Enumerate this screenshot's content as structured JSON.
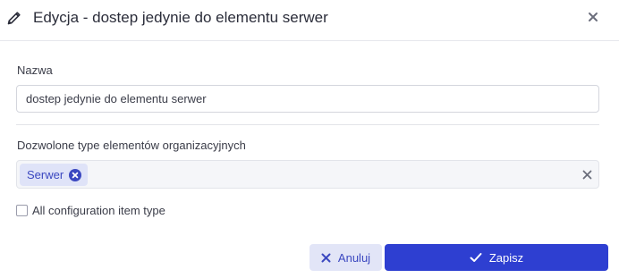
{
  "dialog": {
    "title": "Edycja - dostep jedynie do elementu serwer",
    "edit_icon": "pencil-icon",
    "close_icon": "close-icon"
  },
  "form": {
    "name_label": "Nazwa",
    "name_value": "dostep jedynie do elementu serwer",
    "types_label": "Dozwolone type elementów organizacyjnych",
    "selected_types": [
      "Serwer"
    ],
    "chip_remove_icon": "x-circle-icon",
    "clear_icon": "clear-icon",
    "all_types_label": "All configuration item type",
    "all_types_checked": false
  },
  "actions": {
    "cancel_label": "Anuluj",
    "save_label": "Zapisz"
  },
  "colors": {
    "primary": "#2e3fd1",
    "primary_light": "#e2e5f7",
    "chip_bg": "#dfe3f8",
    "chip_text": "#3b48c0"
  }
}
